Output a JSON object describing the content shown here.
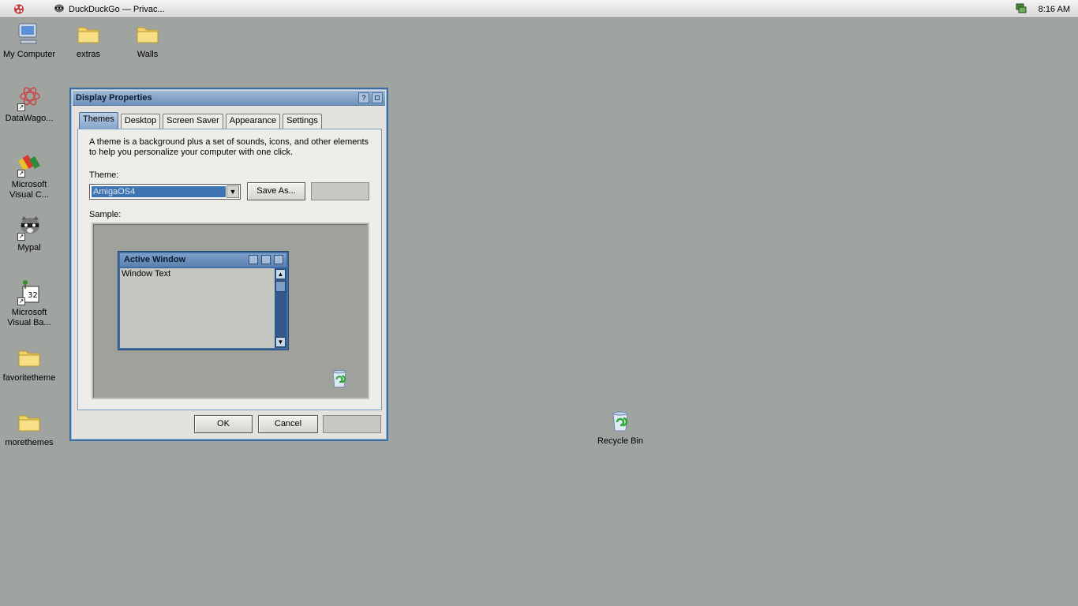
{
  "taskbar": {
    "task_title": "DuckDuckGo — Privac...",
    "clock": "8:16 AM"
  },
  "desktop": {
    "icons": [
      {
        "label": "My Computer"
      },
      {
        "label": "extras"
      },
      {
        "label": "Walls"
      },
      {
        "label": "DataWago..."
      },
      {
        "label": "Microsoft Visual C..."
      },
      {
        "label": "Mypal"
      },
      {
        "label": "Microsoft Visual Ba..."
      },
      {
        "label": "favoritetheme"
      },
      {
        "label": "morethemes"
      },
      {
        "label": "Recycle Bin"
      }
    ]
  },
  "dialog": {
    "title": "Display Properties",
    "tabs": [
      "Themes",
      "Desktop",
      "Screen Saver",
      "Appearance",
      "Settings"
    ],
    "active_tab": "Themes",
    "description": "A theme is a background plus a set of sounds, icons, and other elements to help you personalize your computer with one click.",
    "theme_label": "Theme:",
    "theme_value": "AmigaOS4",
    "save_as": "Save As...",
    "sample_label": "Sample:",
    "sample": {
      "window_title": "Active Window",
      "window_text": "Window Text"
    },
    "ok": "OK",
    "cancel": "Cancel"
  },
  "colors": {
    "desktop_bg": "#a0a4a0",
    "title_blue": "#6e93bd",
    "selection_blue": "#3d74b1"
  }
}
